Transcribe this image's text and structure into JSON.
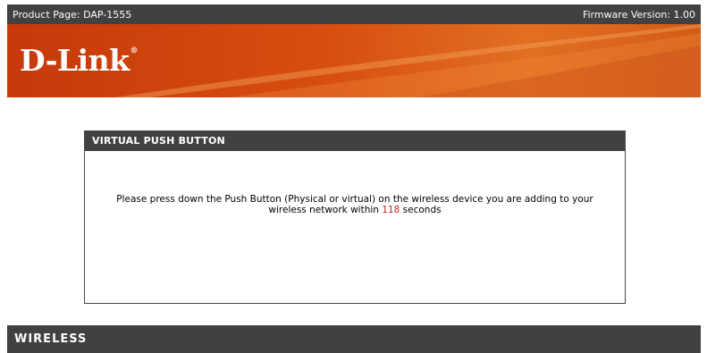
{
  "topbar": {
    "product_page": "Product Page: DAP-1555",
    "firmware_version": "Firmware Version: 1.00"
  },
  "banner": {
    "logo_text": "D-Link",
    "logo_mark": "®"
  },
  "panel": {
    "title": "VIRTUAL PUSH BUTTON",
    "message_line1": "Please press down the Push Button (Physical or virtual) on the wireless device you are adding to your",
    "message_line2_prefix": "wireless network within ",
    "countdown_seconds": "118",
    "message_line2_suffix": " seconds"
  },
  "footer": {
    "label": "WIRELESS"
  },
  "colors": {
    "bar_background": "#3f4142",
    "banner_orange": "#d64d10",
    "countdown_red": "#d21f1f"
  }
}
